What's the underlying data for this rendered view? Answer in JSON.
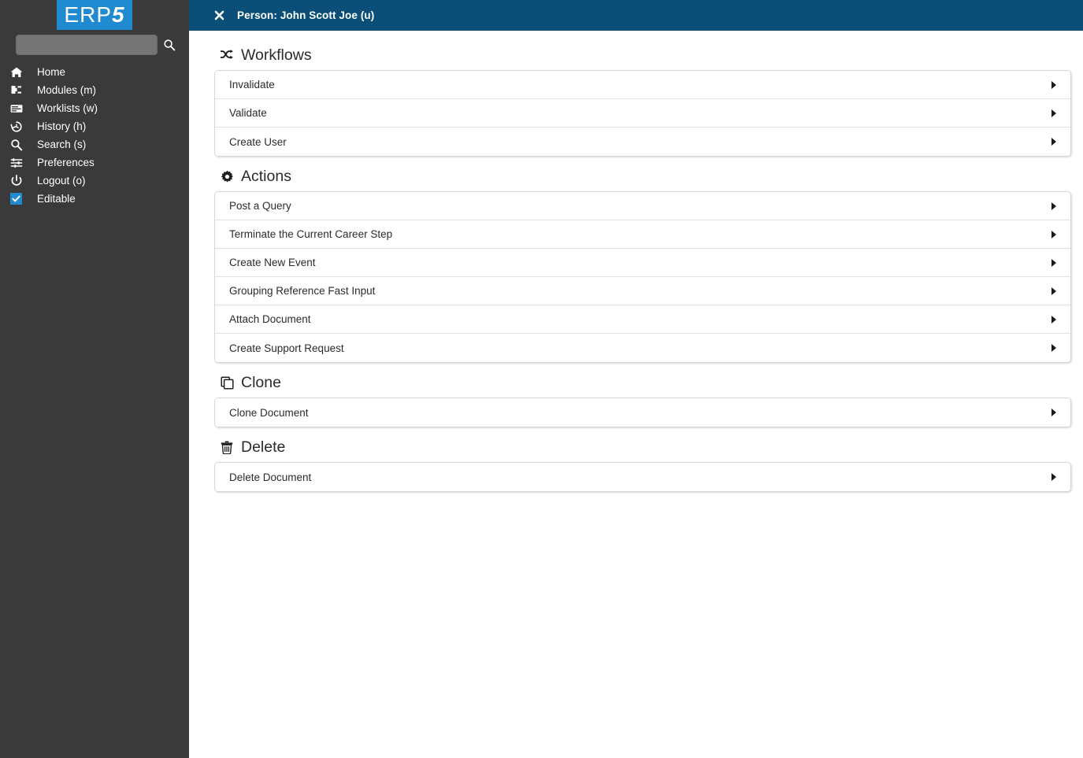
{
  "sidebar": {
    "logo_text_main": "ERP",
    "logo_text_accent": "5",
    "search": {
      "value": "",
      "placeholder": "",
      "icon": "search-icon"
    },
    "items": [
      {
        "label": "Home",
        "icon": "home-icon"
      },
      {
        "label": "Modules (m)",
        "icon": "modules-puzzle-icon"
      },
      {
        "label": "Worklists (w)",
        "icon": "worklists-list-icon"
      },
      {
        "label": "History (h)",
        "icon": "history-clock-icon"
      },
      {
        "label": "Search (s)",
        "icon": "search-icon"
      },
      {
        "label": "Preferences",
        "icon": "sliders-icon"
      },
      {
        "label": "Logout (o)",
        "icon": "power-icon"
      },
      {
        "label": "Editable",
        "icon": "checkbox-checked-icon",
        "checked": true
      }
    ]
  },
  "topbar": {
    "close_icon": "close-icon",
    "title": "Person: John Scott Joe (u)"
  },
  "sections": [
    {
      "id": "workflows",
      "title": "Workflows",
      "icon": "shuffle-icon",
      "items": [
        {
          "label": "Invalidate"
        },
        {
          "label": "Validate"
        },
        {
          "label": "Create User"
        }
      ]
    },
    {
      "id": "actions",
      "title": "Actions",
      "icon": "gear-icon",
      "items": [
        {
          "label": "Post a Query"
        },
        {
          "label": "Terminate the Current Career Step"
        },
        {
          "label": "Create New Event"
        },
        {
          "label": "Grouping Reference Fast Input"
        },
        {
          "label": "Attach Document"
        },
        {
          "label": "Create Support Request"
        }
      ]
    },
    {
      "id": "clone",
      "title": "Clone",
      "icon": "copy-icon",
      "items": [
        {
          "label": "Clone Document"
        }
      ]
    },
    {
      "id": "delete",
      "title": "Delete",
      "icon": "trash-icon",
      "items": [
        {
          "label": "Delete Document"
        }
      ]
    }
  ],
  "colors": {
    "sidebar_bg": "#3a3a3a",
    "logo_bg": "#1f8ad0",
    "topbar_bg": "#0b4f78",
    "accent": "#1f8ad0",
    "row_text": "#2b2b2b",
    "list_border": "#d6d6d6"
  }
}
